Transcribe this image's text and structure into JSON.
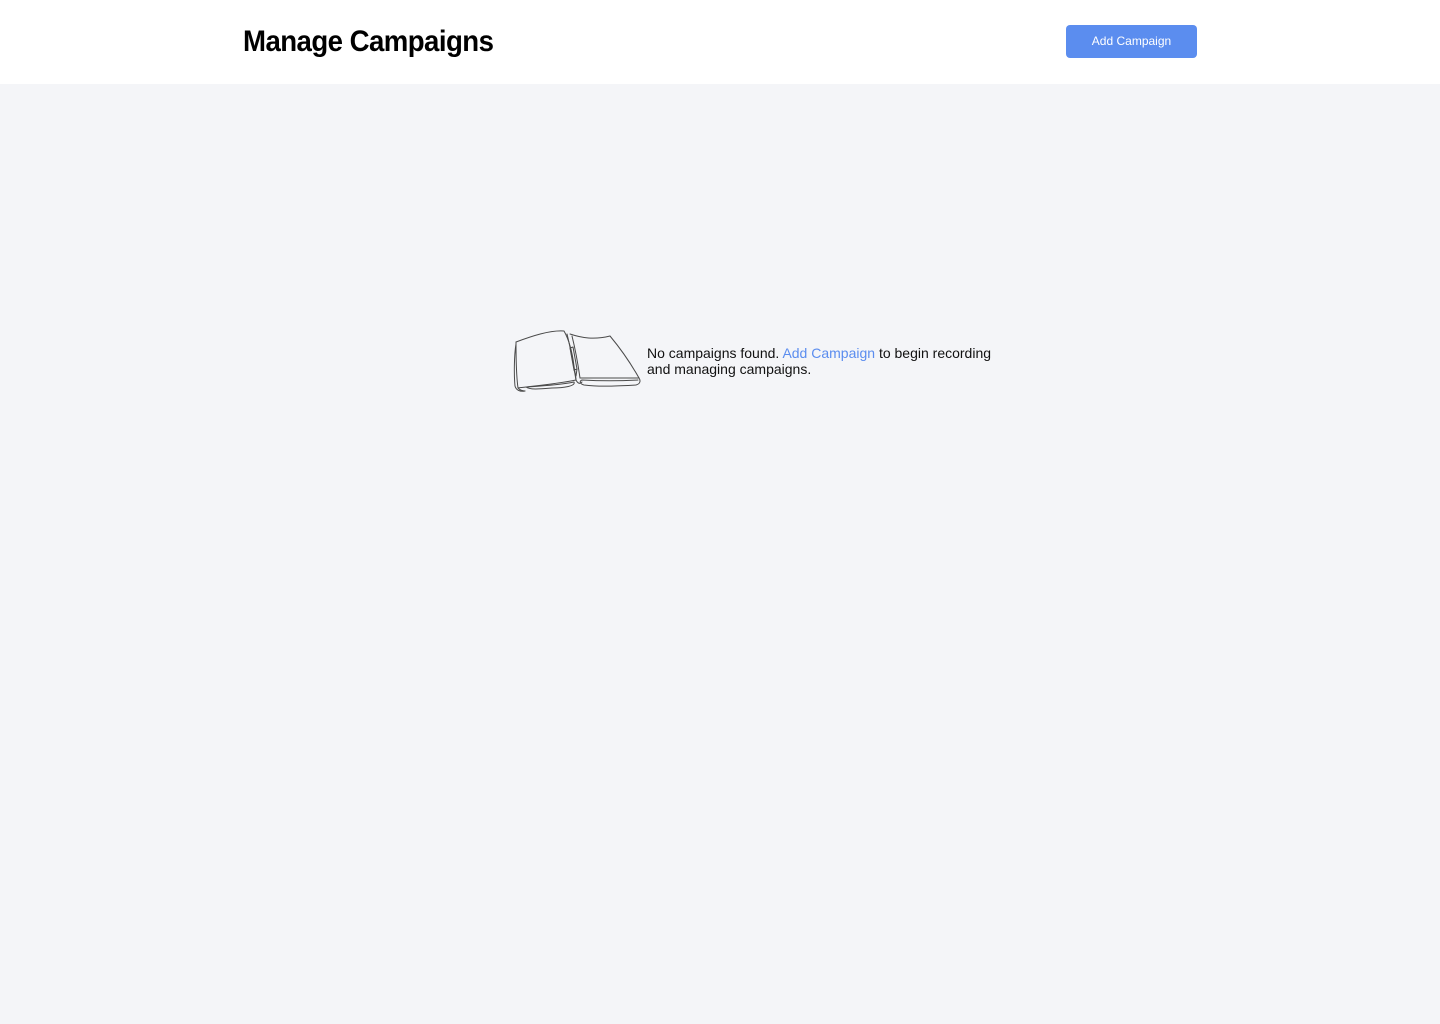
{
  "header": {
    "title": "Manage Campaigns",
    "add_button_label": "Add Campaign"
  },
  "empty_state": {
    "icon": "open-book-icon",
    "text_before": "No campaigns found.",
    "link_label": "Add Campaign",
    "text_after": "to begin recording and managing campaigns."
  },
  "colors": {
    "accent": "#5b8def",
    "background": "#f4f5f8",
    "header_background": "#ffffff"
  }
}
